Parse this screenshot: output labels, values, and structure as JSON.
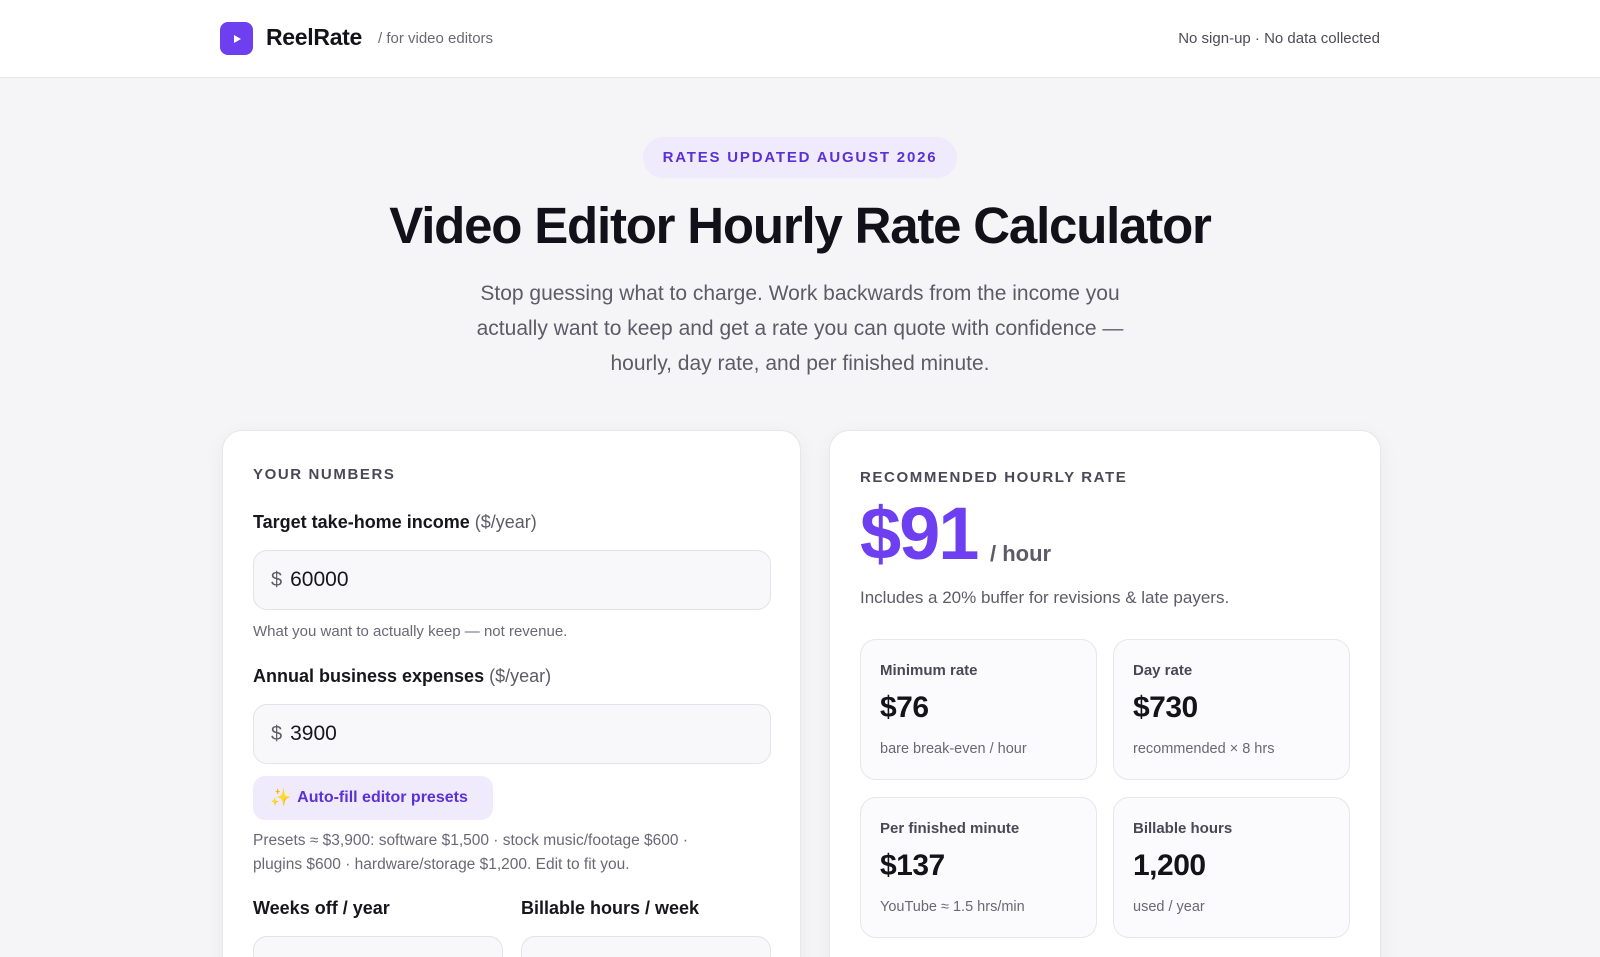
{
  "header": {
    "brand_name": "ReelRate",
    "brand_tagline": "/ for video editors",
    "privacy_note": "No sign-up · No data collected"
  },
  "hero": {
    "badge": "RATES UPDATED AUGUST 2026",
    "title": "Video Editor Hourly Rate Calculator",
    "subtitle_line1": "Stop guessing what to charge. Work backwards from the income you",
    "subtitle_line2": "actually want to keep and get a rate you can quote with confidence —",
    "subtitle_line3": "hourly, day rate, and per finished minute."
  },
  "inputs": {
    "section_label": "YOUR NUMBERS",
    "income": {
      "label": "Target take-home income",
      "unit": "($/year)",
      "currency": "$",
      "value": "60000",
      "hint": "What you want to actually keep — not revenue."
    },
    "expenses": {
      "label": "Annual business expenses",
      "unit": "($/year)",
      "currency": "$",
      "value": "3900"
    },
    "preset_button": "Auto-fill editor presets",
    "preset_note_line1": "Presets ≈ $3,900: software $1,500 · stock music/footage $600 ·",
    "preset_note_line2": "plugins $600 · hardware/storage $1,200. Edit to fit you.",
    "weeks_off_label": "Weeks off / year",
    "billable_hours_label": "Billable hours / week"
  },
  "results": {
    "section_label": "RECOMMENDED HOURLY RATE",
    "rate": "$91",
    "rate_unit": "/ hour",
    "buffer_note": "Includes a 20% buffer for revisions & late payers.",
    "stats": [
      {
        "label": "Minimum rate",
        "value": "$76",
        "note": "bare break-even / hour"
      },
      {
        "label": "Day rate",
        "value": "$730",
        "note": "recommended × 8 hrs"
      },
      {
        "label": "Per finished minute",
        "value": "$137",
        "note": "YouTube ≈ 1.5 hrs/min"
      },
      {
        "label": "Billable hours",
        "value": "1,200",
        "note": "used / year"
      }
    ]
  },
  "colors": {
    "accent": "#6d3ff1",
    "accent_soft": "#efeafc",
    "background": "#f5f5f7"
  },
  "icons": {
    "brand": "play-icon",
    "preset": "sparkles-icon"
  }
}
